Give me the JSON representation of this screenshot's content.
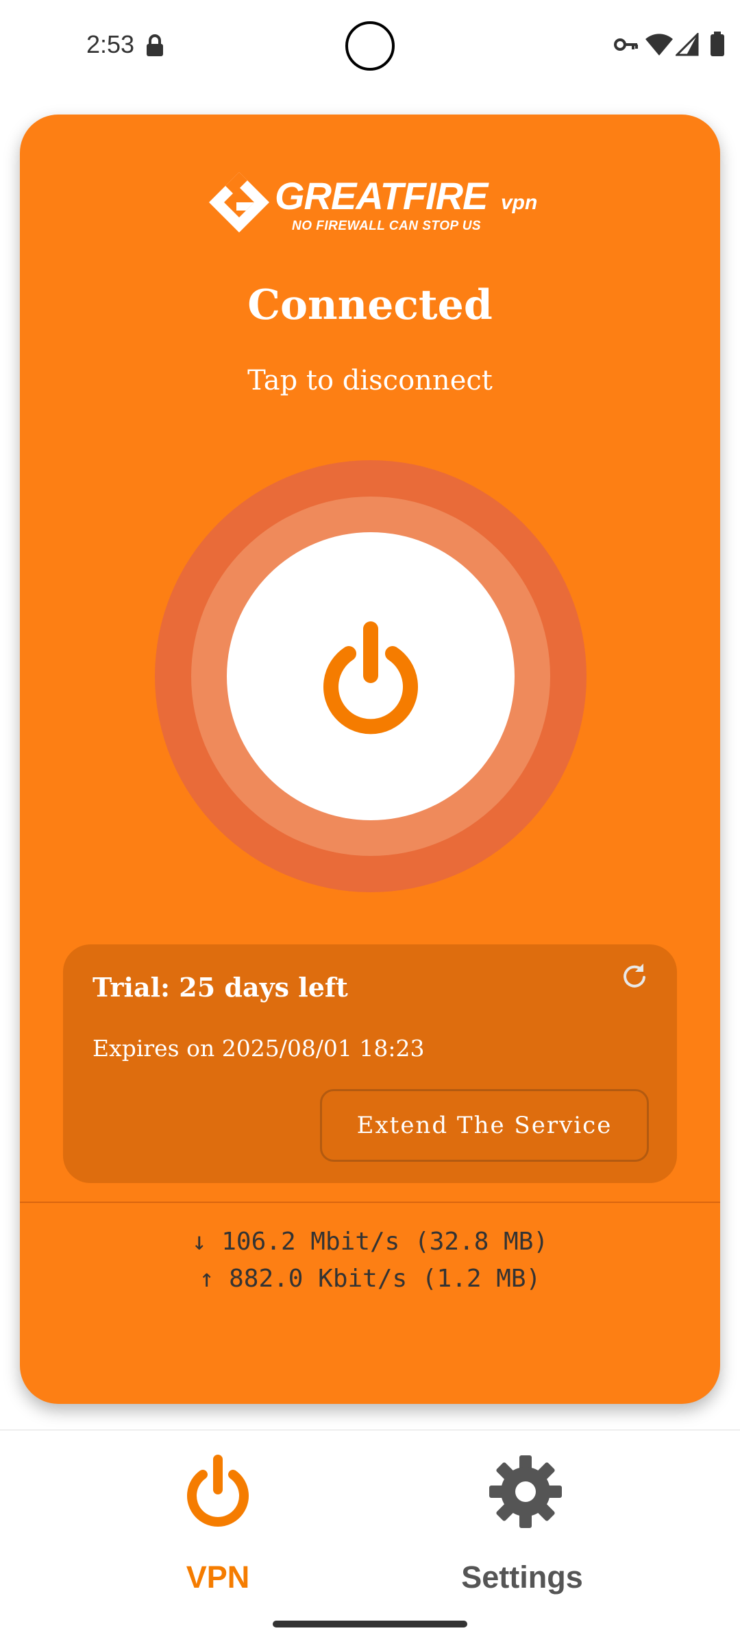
{
  "status_bar": {
    "time": "2:53"
  },
  "app": {
    "logo": {
      "brand": "GREATFIRE",
      "suffix": "vpn",
      "tagline": "NO FIREWALL CAN STOP US"
    },
    "connection": {
      "status": "Connected",
      "hint": "Tap to disconnect"
    },
    "trial": {
      "title": "Trial: 25 days left",
      "expiry": "Expires on 2025/08/01 18:23",
      "extend_label": "Extend The Service"
    },
    "traffic": {
      "download": "↓ 106.2 Mbit/s (32.8 MB)",
      "upload": "↑ 882.0 Kbit/s (1.2 MB)"
    }
  },
  "nav": {
    "items": [
      {
        "label": "VPN",
        "icon": "power-icon",
        "active": true
      },
      {
        "label": "Settings",
        "icon": "gear-icon",
        "active": false
      }
    ]
  },
  "colors": {
    "accent": "#fd7f14",
    "ring_outer": "#e96b39",
    "ring_middle": "#ef8a5b",
    "trial_box": "#de6d0e",
    "nav_active": "#f57c00",
    "nav_inactive": "#555555"
  }
}
